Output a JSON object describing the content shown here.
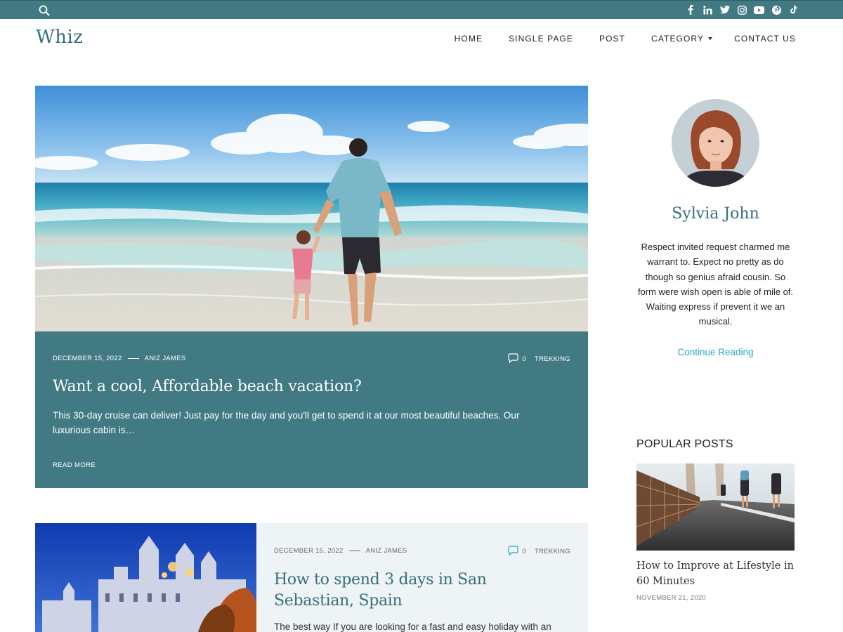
{
  "site": {
    "logo": "Whiz",
    "colors": {
      "brand": "#417a83",
      "heading": "#33707a",
      "link": "#2aa6c6"
    }
  },
  "topbar": {
    "search_icon": "search-icon",
    "social": [
      "facebook-icon",
      "linkedin-icon",
      "twitter-icon",
      "instagram-icon",
      "youtube-icon",
      "pinterest-icon",
      "tiktok-icon"
    ]
  },
  "nav": {
    "items": [
      {
        "label": "HOME"
      },
      {
        "label": "SINGLE PAGE"
      },
      {
        "label": "POST"
      },
      {
        "label": "CATEGORY"
      },
      {
        "label": "CONTACT US"
      }
    ]
  },
  "featured": {
    "image": "beach-father-daughter",
    "date": "DECEMBER 15, 2022",
    "author": "ANIZ JAMES",
    "comments": "0",
    "category": "TREKKING",
    "title": "Want a cool, Affordable beach vacation?",
    "excerpt": "This 30-day cruise can deliver! Just pay for the day and you'll get to spend it at our most beautiful beaches. Our luxurious cabin is…",
    "read_more": "READ MORE"
  },
  "post2": {
    "image": "san-sebastian-palace",
    "date": "DECEMBER 15, 2022",
    "author": "ANIZ JAMES",
    "comments": "0",
    "category": "TREKKING",
    "title": "How to spend 3 days in San Sebastian, Spain",
    "excerpt": "The best way If you are looking for a fast and easy holiday with an"
  },
  "sidebar": {
    "author_name": "Sylvia John",
    "bio": "Respect invited request charmed me warrant to. Expect no pretty as do though so genius afraid cousin. So form were wish open is able of mile of. Waiting express if prevent it we an musical.",
    "continue_label": "Continue Reading",
    "popular_heading": "POPULAR POSTS",
    "popular": {
      "title": "How to Improve at Lifestyle in 60 Minutes",
      "date": "NOVEMBER 21, 2020"
    }
  }
}
